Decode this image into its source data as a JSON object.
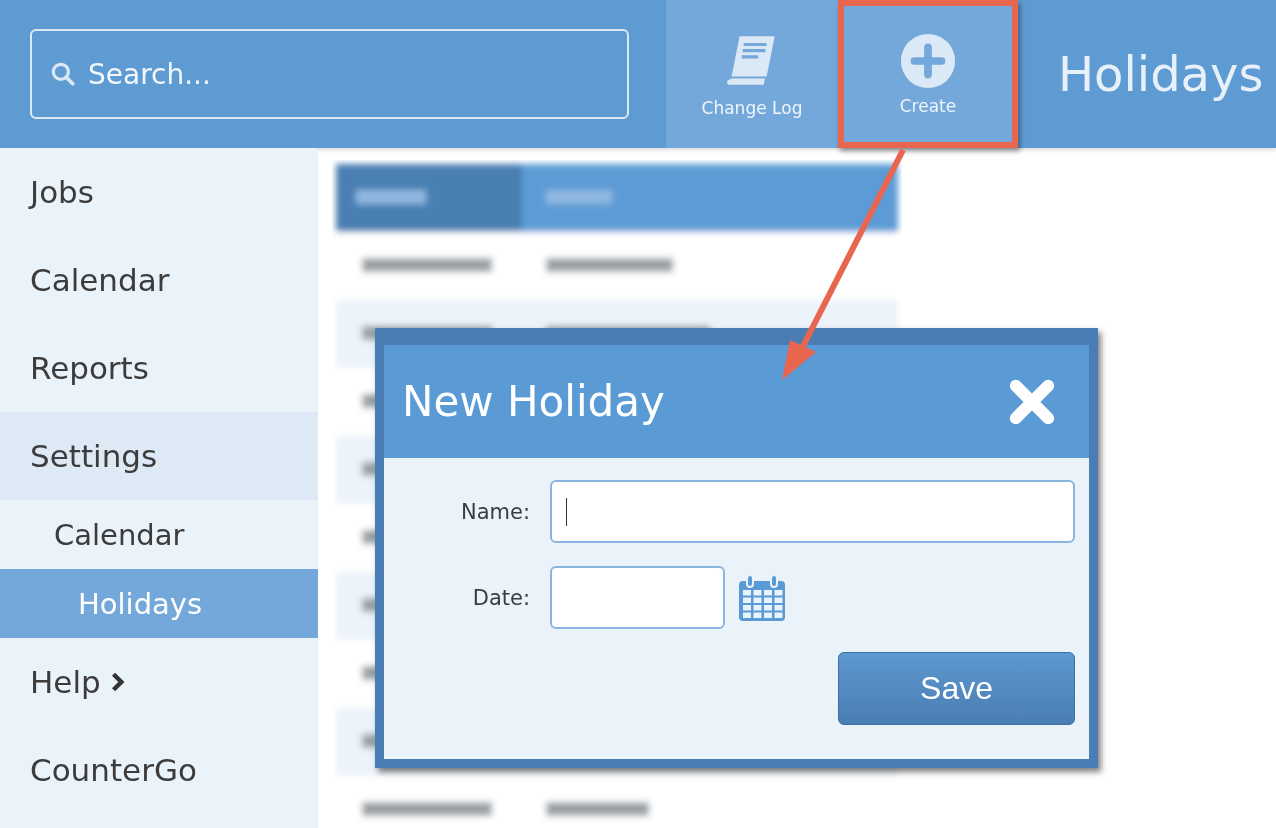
{
  "search": {
    "placeholder": "Search..."
  },
  "toolbar": [
    {
      "label": "Change Log",
      "kind": "log",
      "highlighted": false
    },
    {
      "label": "Create",
      "kind": "create",
      "highlighted": true
    }
  ],
  "page_title": "Holidays",
  "sidebar": {
    "items": [
      {
        "label": "Jobs",
        "selected": false
      },
      {
        "label": "Calendar",
        "selected": false
      },
      {
        "label": "Reports",
        "selected": false
      },
      {
        "label": "Settings",
        "selected": false,
        "expanded": true,
        "children": [
          {
            "label": "Calendar",
            "selected": false
          },
          {
            "label": "Holidays",
            "selected": true
          }
        ]
      },
      {
        "label": "Help",
        "selected": false,
        "submenu": true
      },
      {
        "label": "CounterGo",
        "selected": false
      }
    ]
  },
  "dialog": {
    "title": "New Holiday",
    "fields": [
      {
        "label": "Name:",
        "kind": "text"
      },
      {
        "label": "Date:",
        "kind": "date"
      }
    ],
    "button": "Save"
  }
}
